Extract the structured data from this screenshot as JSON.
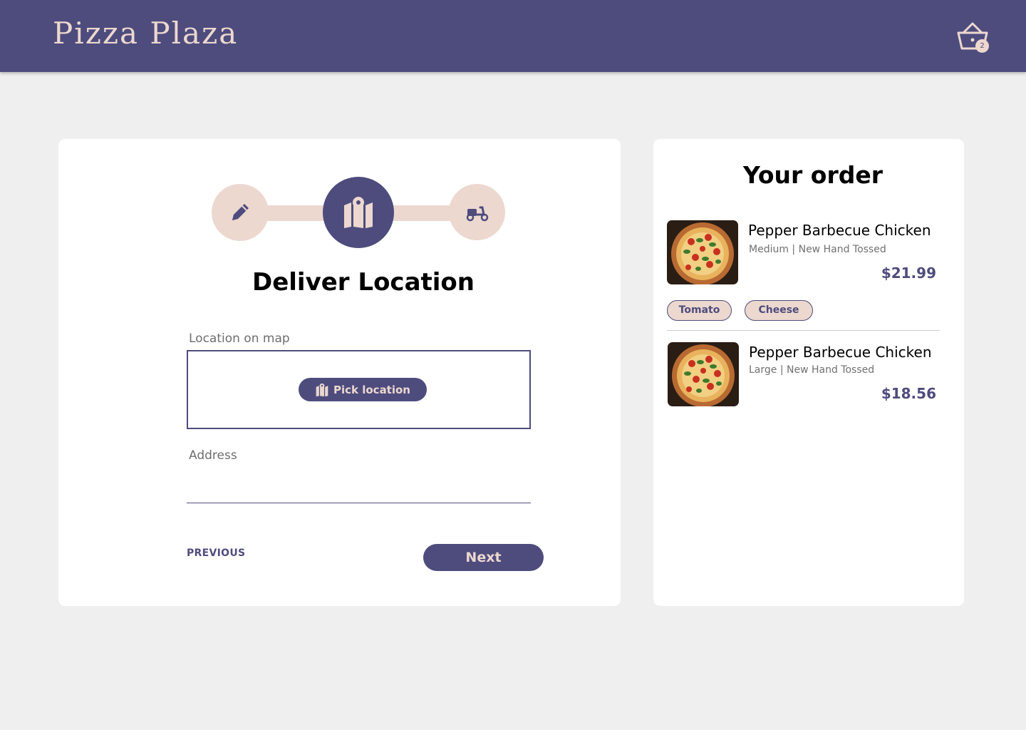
{
  "header": {
    "brand": "Pizza Plaza",
    "cart_count": "2"
  },
  "stepper": {
    "steps": [
      {
        "icon": "pencil-icon",
        "state": "completed"
      },
      {
        "icon": "map-icon",
        "state": "active"
      },
      {
        "icon": "scooter-icon",
        "state": "upcoming"
      }
    ],
    "title": "Deliver Location"
  },
  "form": {
    "map_label": "Location on map",
    "pick_location_label": "Pick location",
    "address_label": "Address",
    "address_value": "",
    "previous_label": "PREVIOUS",
    "next_label": "Next"
  },
  "order": {
    "title": "Your order",
    "items": [
      {
        "name": "Pepper Barbecue Chicken",
        "meta": "Medium |  New Hand Tossed",
        "price": "$21.99",
        "toppings": [
          "Tomato",
          "Cheese"
        ]
      },
      {
        "name": "Pepper Barbecue Chicken",
        "meta": "Large |  New Hand Tossed",
        "price": "$18.56",
        "toppings": []
      }
    ]
  },
  "colors": {
    "primary": "#4e4c7d",
    "accent": "#ecd8cf",
    "background": "#efefef"
  }
}
